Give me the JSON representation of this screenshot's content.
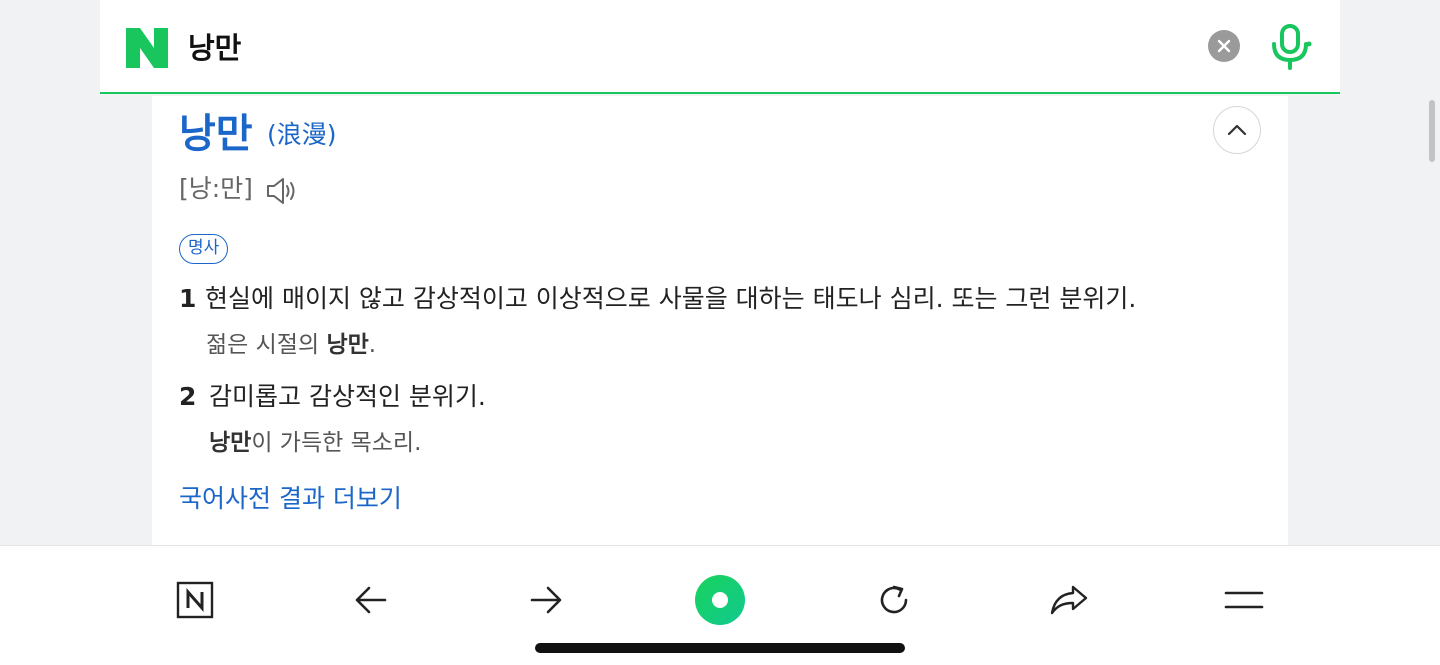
{
  "search": {
    "query": "낭만",
    "logo_icon": "naver-n-logo",
    "clear_icon": "clear-icon",
    "mic_icon": "microphone-icon",
    "accent_color": "#19c65e"
  },
  "dictionary": {
    "headword": "낭만",
    "hanja": "(浪漫)",
    "pronunciation": "[낭:만]",
    "pos": "명사",
    "definitions": [
      {
        "num": "1",
        "text": "현실에 매이지 않고 감상적이고 이상적으로 사물을 대하는 태도나 심리. 또는 그런 분위기.",
        "example_pre": "젊은 시절의 ",
        "example_bold": "낭만",
        "example_post": "."
      },
      {
        "num": "2",
        "text": "감미롭고 감상적인 분위기.",
        "example_pre": "",
        "example_bold": "낭만",
        "example_post": "이 가득한 목소리."
      }
    ],
    "more_link": "국어사전 결과 더보기",
    "link_color": "#1b66c9"
  },
  "bottom_nav": {
    "items": [
      "naver-home-icon",
      "back-arrow-icon",
      "forward-arrow-icon",
      "green-dot-icon",
      "reload-icon",
      "share-icon",
      "menu-icon"
    ]
  }
}
